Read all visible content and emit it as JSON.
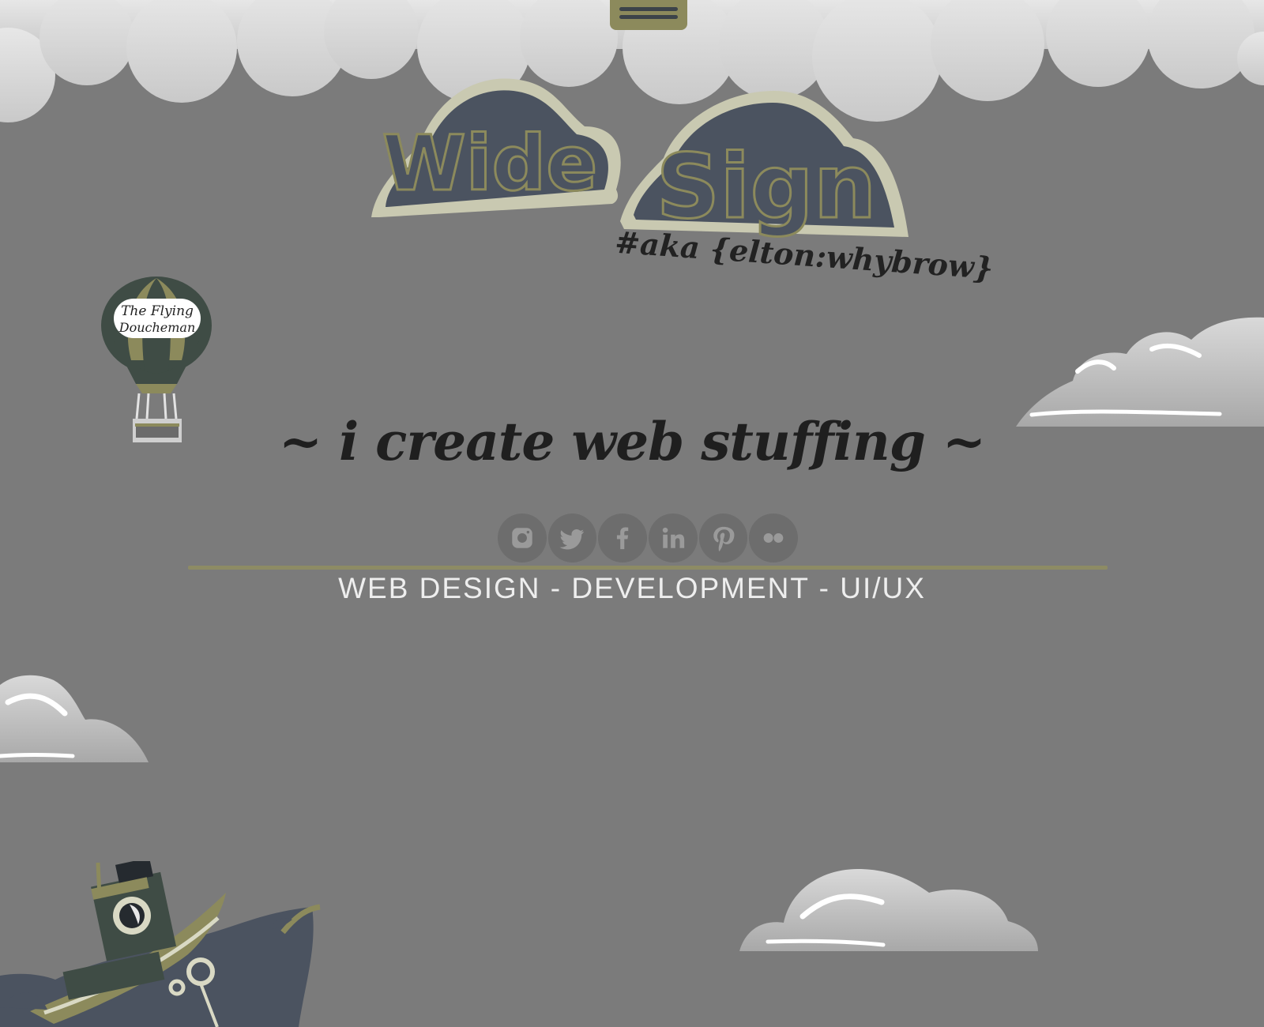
{
  "header": {
    "menu_icon": "hamburger-icon",
    "logo_text": "Wide Sign",
    "aka_text": "#aka {elton:whybrow}"
  },
  "balloon": {
    "badge_line_1": "The Flying",
    "badge_line_2": "Doucheman"
  },
  "hero": {
    "tagline": "~ i create web stuffing ~",
    "services": "WEB DESIGN - DEVELOPMENT - UI/UX"
  },
  "social": [
    {
      "name": "instagram",
      "icon": "instagram-icon"
    },
    {
      "name": "twitter",
      "icon": "twitter-icon"
    },
    {
      "name": "facebook",
      "icon": "facebook-icon"
    },
    {
      "name": "linkedin",
      "icon": "linkedin-icon"
    },
    {
      "name": "pinterest",
      "icon": "pinterest-icon"
    },
    {
      "name": "flickr",
      "icon": "flickr-icon"
    }
  ],
  "colors": {
    "background": "#7b7b7b",
    "olive": "#8c8a5c",
    "slate": "#4b5360",
    "cloud": "#d7d7d7",
    "text_dark": "#1f1f1f",
    "text_light": "#eeeeee"
  }
}
